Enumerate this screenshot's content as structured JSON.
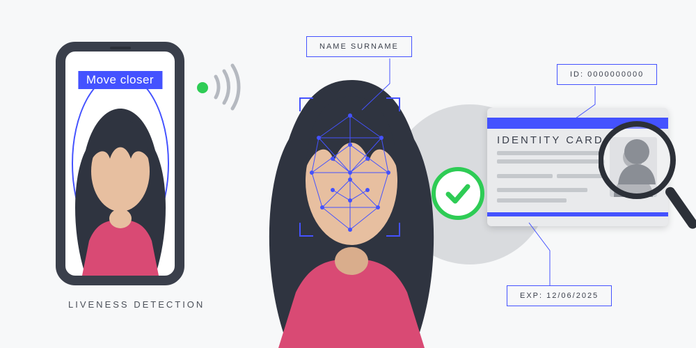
{
  "phone": {
    "prompt": "Move closer",
    "caption": "LIVENESS DETECTION"
  },
  "callouts": {
    "name": "NAME SURNAME",
    "id": "ID: 0000000000",
    "exp": "EXP: 12/06/2025"
  },
  "idcard": {
    "title": "IDENTITY CARD"
  },
  "colors": {
    "accent": "#4452ff",
    "success": "#2ecc55",
    "dark": "#3a3f4b"
  }
}
